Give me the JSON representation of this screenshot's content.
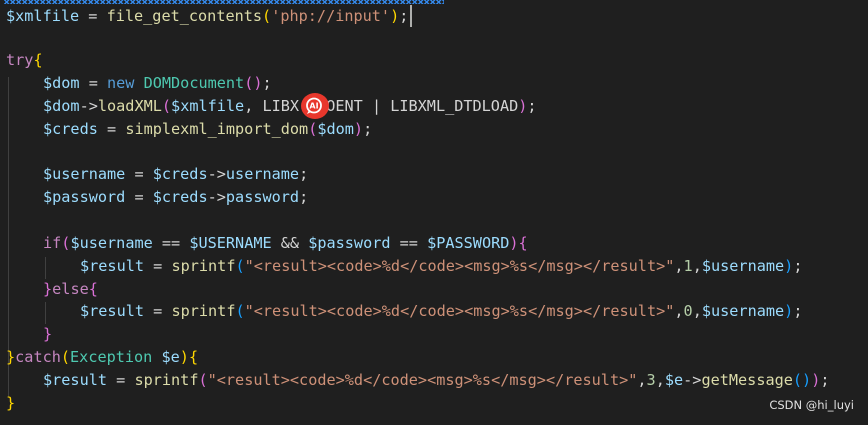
{
  "code": {
    "l1": {
      "var": "$xmlfile",
      "eq": " = ",
      "fn": "file_get_contents",
      "po": "(",
      "str": "'php://input'",
      "pc": ")",
      "semi": ";"
    },
    "l2": {
      "kw": "try",
      "br": "{"
    },
    "l3": {
      "var": "$dom",
      "eq": " = ",
      "kw": "new",
      "sp": " ",
      "cls": "DOMDocument",
      "par": "()",
      "semi": ";"
    },
    "l4": {
      "var": "$dom",
      "arrow": "->",
      "fn": "loadXML",
      "po": "(",
      "arg": "$xmlfile",
      "mid": ", LIBX",
      "rest": "NOENT | LIBXML_DTDLOAD",
      "pc": ")",
      "semi": ";"
    },
    "l5": {
      "var": "$creds",
      "eq": " = ",
      "fn": "simplexml_import_dom",
      "po": "(",
      "arg": "$dom",
      "pc": ")",
      "semi": ";"
    },
    "l6": {
      "var": "$username",
      "eq": " = ",
      "var2": "$creds",
      "arrow": "->",
      "prop": "username",
      "semi": ";"
    },
    "l7": {
      "var": "$password",
      "eq": " = ",
      "var2": "$creds",
      "arrow": "->",
      "prop": "password",
      "semi": ";"
    },
    "l8": {
      "kw": "if",
      "po": "(",
      "v1": "$username",
      "o1": " == ",
      "v2": "$USERNAME",
      "o2": " && ",
      "v3": "$password",
      "o3": " == ",
      "v4": "$PASSWORD",
      "pc": ")",
      "br": "{"
    },
    "l9": {
      "var": "$result",
      "eq": " = ",
      "fn": "sprintf",
      "po": "(",
      "str": "\"<result><code>%d</code><msg>%s</msg></result>\"",
      "c1": ",",
      "num": "1",
      "c2": ",",
      "arg": "$username",
      "pc": ")",
      "semi": ";"
    },
    "l10": {
      "bc": "}",
      "kw": "else",
      "bo": "{"
    },
    "l11": {
      "var": "$result",
      "eq": " = ",
      "fn": "sprintf",
      "po": "(",
      "str": "\"<result><code>%d</code><msg>%s</msg></result>\"",
      "c1": ",",
      "num": "0",
      "c2": ",",
      "arg": "$username",
      "pc": ")",
      "semi": ";"
    },
    "l12": {
      "bc": "}"
    },
    "l13": {
      "bc": "}",
      "kw": "catch",
      "po": "(",
      "cls": "Exception",
      "sp": " ",
      "var": "$e",
      "pc": ")",
      "bo": "{"
    },
    "l14": {
      "var": "$result",
      "eq": " = ",
      "fn": "sprintf",
      "po": "(",
      "str": "\"<result><code>%d</code><msg>%s</msg></result>\"",
      "c1": ",",
      "num": "3",
      "c2": ",",
      "arg": "$e",
      "arrow": "->",
      "fn2": "getMessage",
      "par": "()",
      "pc": ")",
      "semi": ";"
    },
    "l15": {
      "bc": "}"
    }
  },
  "overlay": {
    "badge_icon": "ai-assistant-icon",
    "badge_color": "#e8372c"
  },
  "watermark": {
    "text": "CSDN @hi_luyi"
  }
}
